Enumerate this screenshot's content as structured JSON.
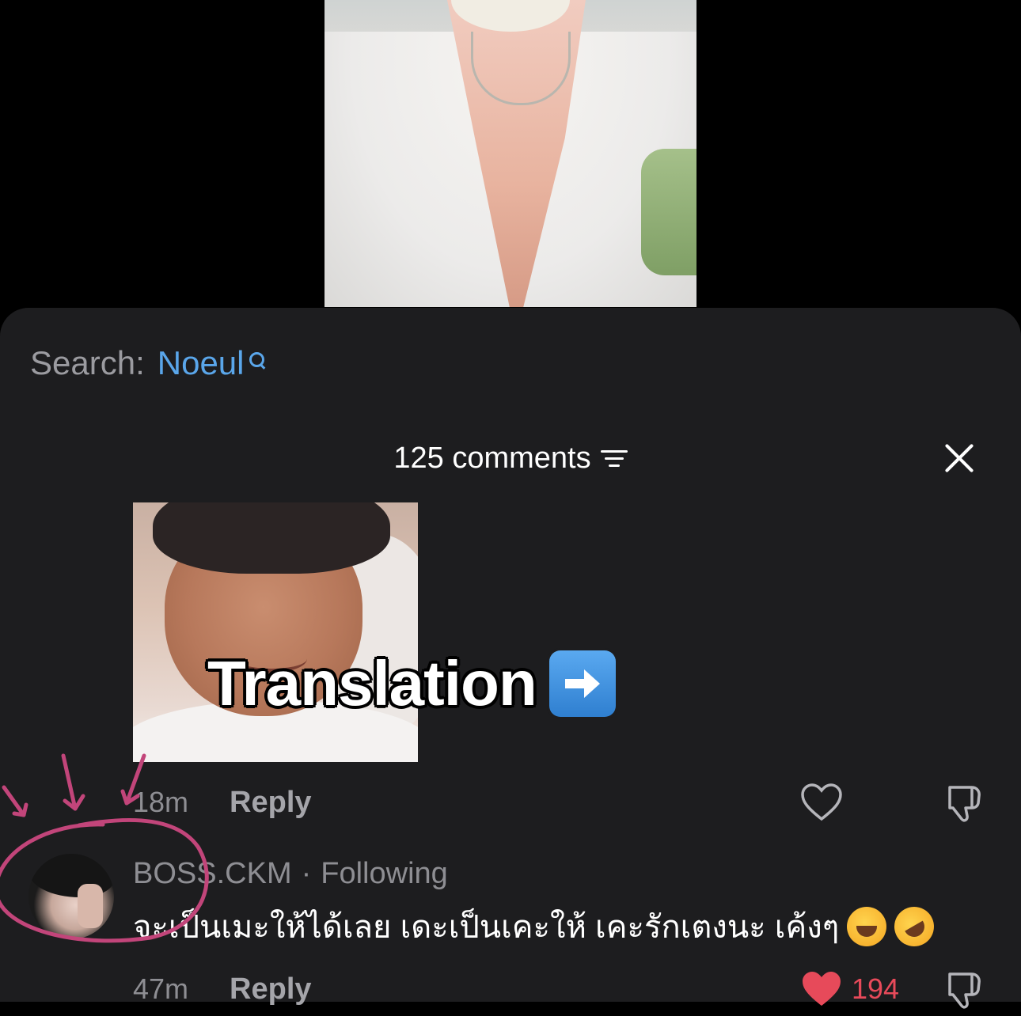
{
  "search": {
    "label": "Search:",
    "term": "Noeul"
  },
  "comments_header": {
    "count_label": "125 comments"
  },
  "sticker": {
    "overlay_text": "Translation"
  },
  "comment1": {
    "time": "18m",
    "reply_label": "Reply"
  },
  "comment2": {
    "username": "BOSS.CKM",
    "separator": "·",
    "follow_status": "Following",
    "text": "จะเป็นเมะให้ได้เลย เดะเป็นเคะให้ เคะรักเตงนะ เค้งๆ",
    "time": "47m",
    "reply_label": "Reply",
    "like_count": "194"
  },
  "colors": {
    "accent_link": "#5aa6ea",
    "sheet_bg": "#1d1d1f",
    "like_red": "#e74a5a",
    "annotation_pink": "#c2457a"
  },
  "icons": [
    "search-icon",
    "filter-icon",
    "close-icon",
    "arrow-right-icon",
    "heart-icon",
    "dislike-icon",
    "laughing-tears-emoji",
    "rofl-emoji"
  ]
}
